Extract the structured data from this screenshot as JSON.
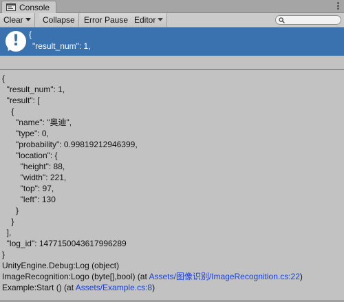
{
  "window": {
    "tab_title": "Console"
  },
  "toolbar": {
    "clear_label": "Clear",
    "collapse_label": "Collapse",
    "error_pause_label": "Error Pause",
    "editor_label": "Editor",
    "search_placeholder": ""
  },
  "selected_entry": {
    "line1": "{",
    "line2": "\"result_num\": 1,"
  },
  "detail": {
    "json_lines": [
      "{",
      "  \"result_num\": 1,",
      "  \"result\": [",
      "    {",
      "      \"name\": \"奥迪\",",
      "      \"type\": 0,",
      "      \"probability\": 0.99819212946399,",
      "      \"location\": {",
      "        \"height\": 88,",
      "        \"width\": 221,",
      "        \"top\": 97,",
      "        \"left\": 130",
      "      }",
      "    }",
      "  ],",
      "  \"log_id\": 1477150043617996289",
      "}"
    ],
    "stack": {
      "line1": "UnityEngine.Debug:Log (object)",
      "line2_prefix": "ImageRecognition:Logo (byte[],bool) (at ",
      "line2_link": "Assets/图像识别/ImageRecognition.cs:22",
      "line2_suffix": ")",
      "line3_prefix": "Example:Start () (at ",
      "line3_link": "Assets/Example.cs:8",
      "line3_suffix": ")"
    }
  },
  "colors": {
    "selection": "#3a72b0",
    "link": "#1a3fd6",
    "panel_bg": "#c2c2c2"
  }
}
